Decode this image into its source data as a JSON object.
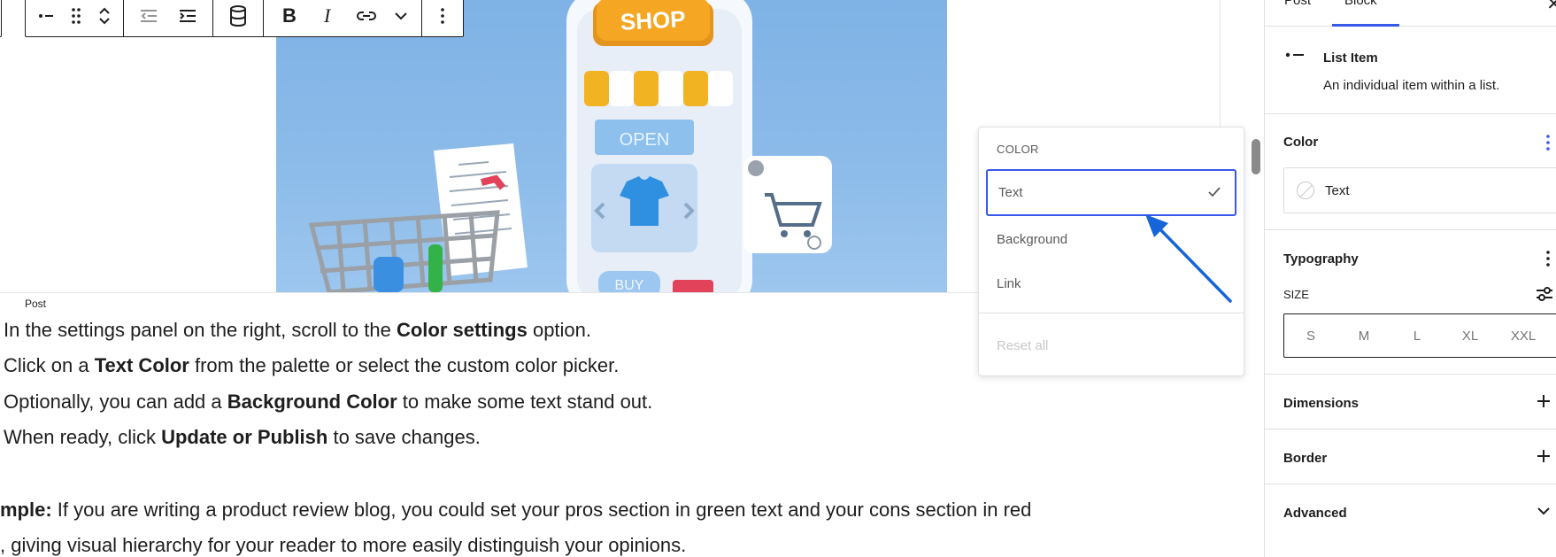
{
  "toolbar": {
    "icons": [
      "list-item-icon",
      "drag-handle-icon",
      "move-up-icon",
      "move-down-icon",
      "outdent-icon",
      "indent-icon",
      "database-icon",
      "bold-icon",
      "italic-icon",
      "link-icon",
      "chevron-down-icon",
      "more-options-icon"
    ]
  },
  "hero": {
    "sign_text": "SHOP",
    "open_text": "OPEN",
    "buy_text": "BUY"
  },
  "canvas": {
    "post_label": "Post",
    "list_items": [
      {
        "before": "In the settings panel on the right, scroll to the ",
        "bold": "Color settings",
        "after": " option."
      },
      {
        "before": "Click on a ",
        "bold": "Text Color",
        "after": " from the palette or select the custom color picker."
      },
      {
        "before": "Optionally, you can add a ",
        "bold": "Background Color",
        "after": " to make some text stand out."
      },
      {
        "before": "When ready, click ",
        "bold": "Update or Publish",
        "after": " to save changes."
      }
    ],
    "paragraph": {
      "line1_bold": "mple:",
      "line1_rest": " If you are writing a product review blog, you could set your pros section in green text and your cons section in red",
      "line2": ", giving visual hierarchy for your reader to more easily distinguish your opinions."
    }
  },
  "color_popover": {
    "heading": "COLOR",
    "items": [
      "Text",
      "Background",
      "Link"
    ],
    "selected": "Text",
    "reset_label": "Reset all"
  },
  "sidebar": {
    "tabs": [
      "Post",
      "Block"
    ],
    "active_tab": "Block",
    "block": {
      "name": "List Item",
      "description": "An individual item within a list."
    },
    "panels": {
      "color": {
        "title": "Color",
        "text_button": "Text"
      },
      "typography": {
        "title": "Typography",
        "size_label": "SIZE",
        "sizes": [
          "S",
          "M",
          "L",
          "XL",
          "XXL"
        ]
      },
      "dimensions": {
        "title": "Dimensions"
      },
      "border": {
        "title": "Border"
      },
      "advanced": {
        "title": "Advanced"
      }
    }
  },
  "colors": {
    "accent": "#3858e9",
    "annotation_arrow": "#1565d8",
    "hero_sky": "#8cbbe9",
    "shop_sign": "#f0a21a"
  }
}
